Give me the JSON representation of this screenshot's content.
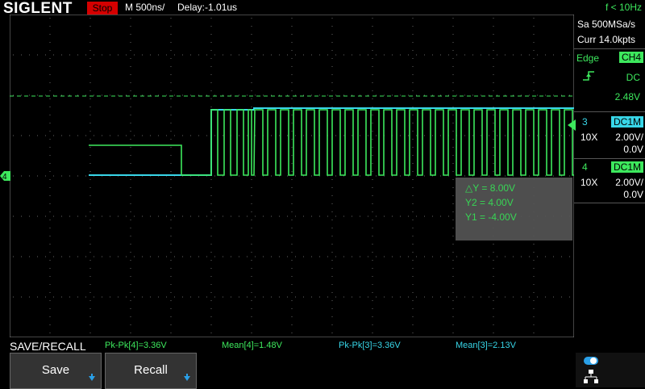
{
  "header": {
    "logo": "SIGLENT",
    "run_status": "Stop",
    "timebase": "M 500ns/",
    "delay": "Delay:-1.01us",
    "trigger_freq": "f < 10Hz"
  },
  "acquisition": {
    "sample_rate": "Sa 500MSa/s",
    "memory": "Curr 14.0kpts"
  },
  "trigger": {
    "type": "Edge",
    "source": "CH4",
    "slope_icon": "rising-edge-icon",
    "coupling": "DC",
    "level": "2.48V"
  },
  "channels": [
    {
      "number": "3",
      "coupling": "DC1M",
      "probe": "10X",
      "scale": "2.00V/",
      "offset": "0.0V",
      "color": "#38d6e8"
    },
    {
      "number": "4",
      "coupling": "DC1M",
      "probe": "10X",
      "scale": "2.00V/",
      "offset": "0.0V",
      "color": "#3de85d"
    }
  ],
  "cursor_readout": {
    "delta_y": "△Y = 8.00V",
    "y2": "Y2 = 4.00V",
    "y1": "Y1 = -4.00V"
  },
  "menu_title": "SAVE/RECALL",
  "measurements": [
    {
      "text": "Pk-Pk[4]=3.36V",
      "color": "#3de85d"
    },
    {
      "text": "Mean[4]=1.48V",
      "color": "#3de85d"
    },
    {
      "text": "Pk-Pk[3]=3.36V",
      "color": "#38d6e8"
    },
    {
      "text": "Mean[3]=2.13V",
      "color": "#38d6e8"
    }
  ],
  "softkeys": [
    {
      "label": "Save"
    },
    {
      "label": "Recall"
    }
  ],
  "markers": {
    "ch4_ground": "4"
  },
  "colors": {
    "ch3": "#38d6e8",
    "ch4": "#3de85d",
    "stop": "#d40000",
    "trigger_marker": "#2aa0e8"
  }
}
